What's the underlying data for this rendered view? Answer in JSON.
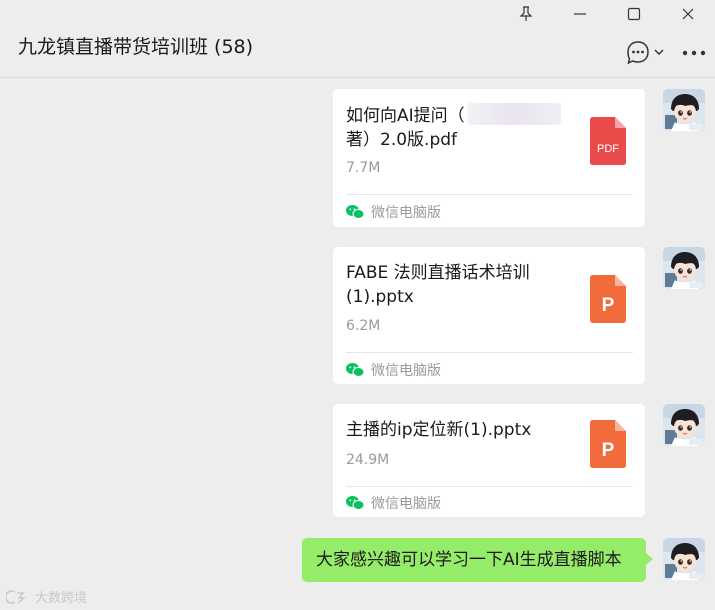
{
  "window": {
    "pin_icon": "pin-icon",
    "minimize_icon": "minimize-icon",
    "maximize_icon": "maximize-icon",
    "close_icon": "close-icon"
  },
  "chat": {
    "title": "九龙镇直播带货培训班 (58)"
  },
  "messages": [
    {
      "type": "file",
      "name_line1": "如何向AI提问（",
      "name_line2": "著）2.0版.pdf",
      "size": "7.7M",
      "icon_label": "PDF",
      "icon_color": "#e94b4b",
      "source": "微信电脑版"
    },
    {
      "type": "file",
      "name_line1": "FABE 法则直播话术培训",
      "name_line2": "(1).pptx",
      "size": "6.2M",
      "icon_label": "P",
      "icon_color": "#f26b3c",
      "source": "微信电脑版"
    },
    {
      "type": "file",
      "name_line1": "主播的ip定位新(1).pptx",
      "size": "24.9M",
      "icon_label": "P",
      "icon_color": "#f26b3c",
      "source": "微信电脑版"
    },
    {
      "type": "text",
      "text": "大家感兴趣可以学习一下AI生成直播脚本",
      "bubble_color": "#95ec69"
    }
  ],
  "watermark": "大数跨境",
  "colors": {
    "background": "#ededed",
    "card": "#ffffff",
    "secondary_text": "#9a9a9a",
    "wechat_green": "#07c160"
  }
}
